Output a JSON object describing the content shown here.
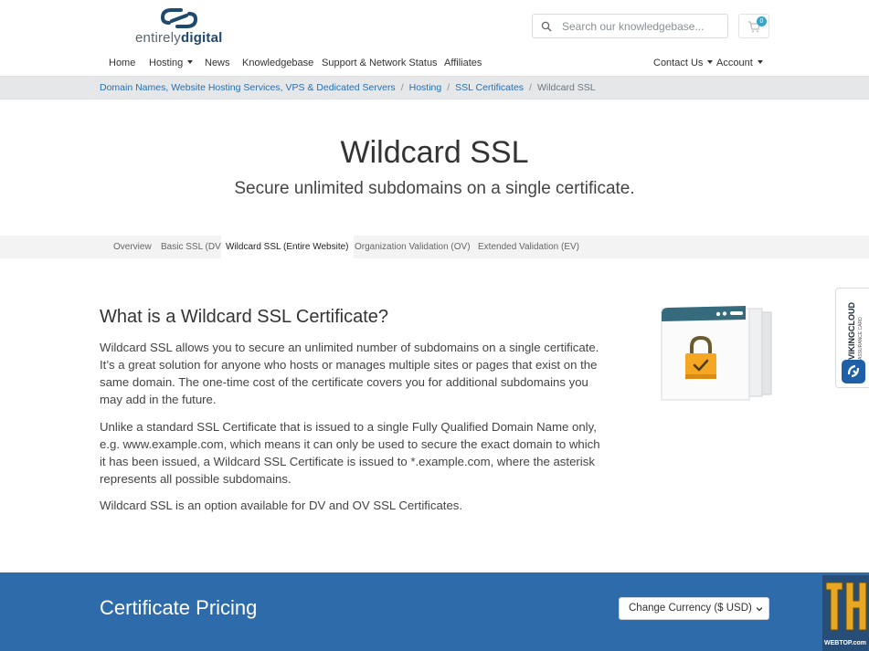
{
  "brand": {
    "logo_light": "entirely",
    "logo_bold": "digital",
    "accent": "#1f4a6e"
  },
  "search": {
    "placeholder": "Search our knowledgebase...",
    "icon": "search-icon"
  },
  "cart": {
    "count": "0",
    "icon": "cart-icon",
    "badge_color": "#2ea8c7"
  },
  "nav": {
    "left": [
      "Home",
      "Hosting",
      "News",
      "Knowledgebase",
      "Support & Network Status",
      "Affiliates"
    ],
    "right": [
      "Contact Us",
      "Account"
    ]
  },
  "breadcrumb": {
    "items": [
      "Domain Names, Website Hosting Services, VPS & Dedicated Servers",
      "Hosting",
      "SSL Certificates"
    ],
    "current": "Wildcard SSL",
    "separator": "/"
  },
  "hero": {
    "title": "Wildcard SSL",
    "subtitle": "Secure unlimited subdomains on a single certificate."
  },
  "tabs": [
    "Overview",
    "Basic SSL (DV)",
    "Wildcard SSL (Entire Website)",
    "Organization Validation (OV)",
    "Extended Validation (EV)"
  ],
  "content": {
    "heading": "What is a Wildcard SSL Certificate?",
    "paragraphs": [
      "Wildcard SSL allows you to secure an unlimited number of subdomains on a single certificate. It’s a great solution for anyone who hosts or manages multiple sites or pages that exist on the same domain. The one-time cost of the certificate covers you for additional subdomains you may add in the future.",
      "Unlike a standard SSL Certificate that is issued to a single Fully Qualified Domain Name only, e.g. www.example.com, which means it can only be used to secure the exact domain to which it has been issued, a Wildcard SSL Certificate is issued to *.example.com, where the asterisk represents all possible subdomains.",
      "Wildcard SSL is an option available for DV and OV SSL Certificates."
    ]
  },
  "viking": {
    "line1": "VIKINGCLOUD",
    "line2": "ASSURANCE CARD"
  },
  "pricing": {
    "title": "Certificate Pricing",
    "currency": "Change Currency ($ USD)",
    "band_color": "#2e6bab"
  },
  "watermark": {
    "text": "WEBTOP.com"
  }
}
